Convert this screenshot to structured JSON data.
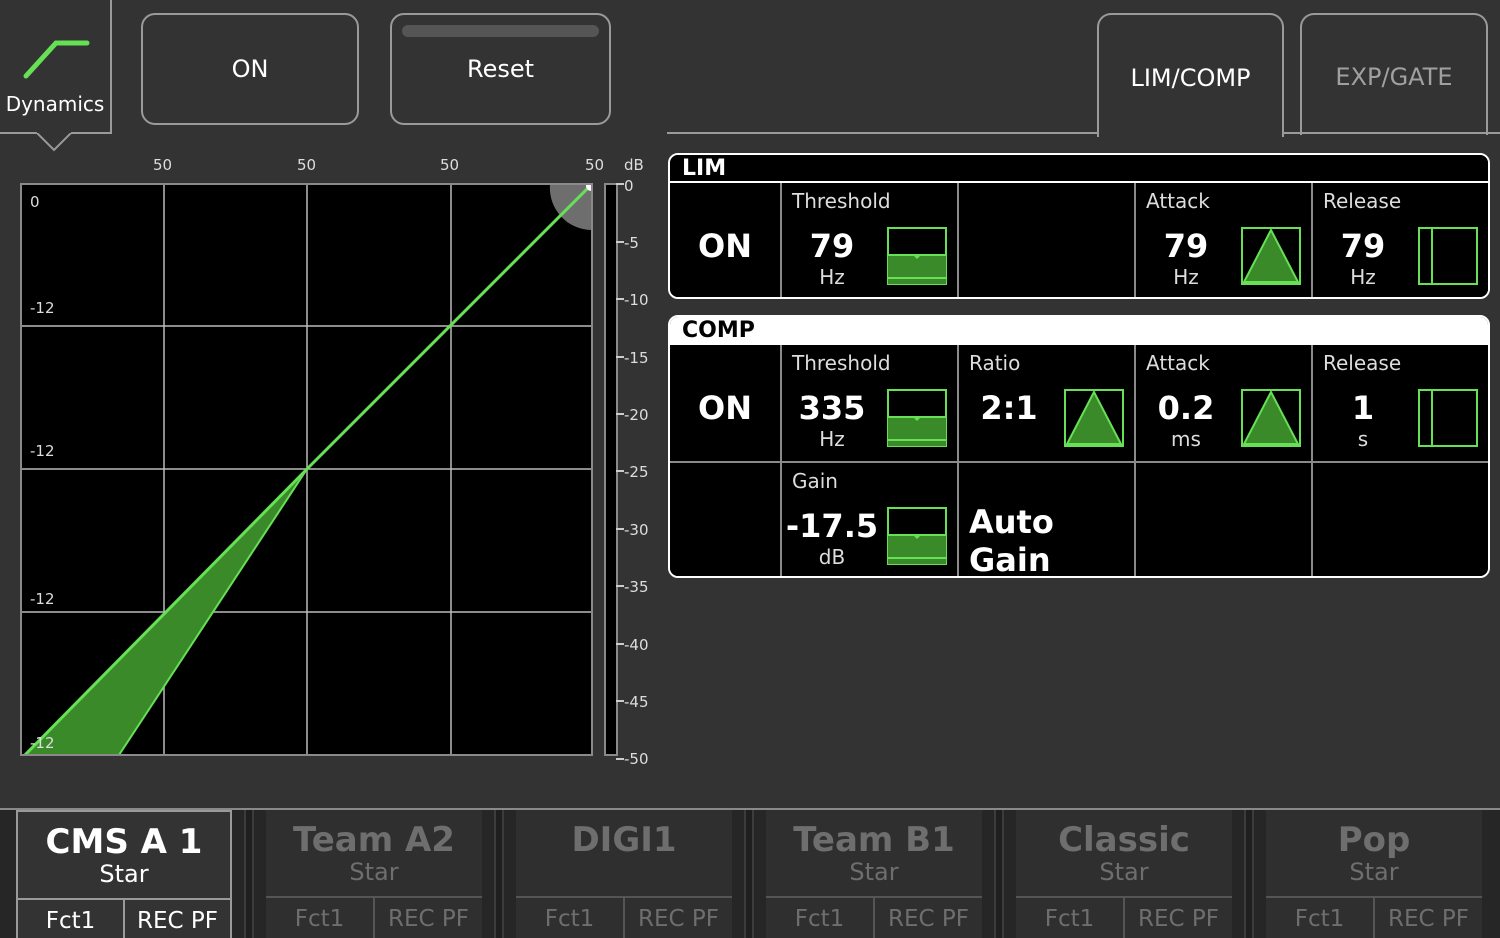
{
  "header": {
    "module_label": "Dynamics",
    "on_label": "ON",
    "reset_label": "Reset"
  },
  "tabs": [
    {
      "label": "LIM/COMP",
      "active": true
    },
    {
      "label": "EXP/GATE",
      "active": false
    }
  ],
  "graph": {
    "x_ticks": [
      "50",
      "50",
      "50",
      "50"
    ],
    "x_unit": "dB",
    "y_labels": [
      "0",
      "-12",
      "-12",
      "-12",
      "-12"
    ],
    "meter_scale": [
      "0",
      "-5",
      "-10",
      "-15",
      "-20",
      "-25",
      "-30",
      "-35",
      "-40",
      "-45",
      "-50"
    ],
    "accent_color": "#66e055",
    "fill_color": "#3a8a2a"
  },
  "lim": {
    "title": "LIM",
    "state": "ON",
    "threshold": {
      "label": "Threshold",
      "value": "79",
      "unit": "Hz"
    },
    "attack": {
      "label": "Attack",
      "value": "79",
      "unit": "Hz"
    },
    "release": {
      "label": "Release",
      "value": "79",
      "unit": "Hz"
    }
  },
  "comp": {
    "title": "COMP",
    "state": "ON",
    "threshold": {
      "label": "Threshold",
      "value": "335",
      "unit": "Hz"
    },
    "ratio": {
      "label": "Ratio",
      "value": "2:1"
    },
    "attack": {
      "label": "Attack",
      "value": "0.2",
      "unit": "ms"
    },
    "release": {
      "label": "Release",
      "value": "1",
      "unit": "s"
    },
    "gain": {
      "label": "Gain",
      "value": "-17.5",
      "unit": "dB"
    },
    "auto_gain": "Auto Gain"
  },
  "channels": [
    {
      "name": "CMS A 1",
      "sub": "Star",
      "f1": "Fct1",
      "f2": "REC PF",
      "active": true
    },
    {
      "name": "Team A2",
      "sub": "Star",
      "f1": "Fct1",
      "f2": "REC PF",
      "active": false
    },
    {
      "name": "DIGI1",
      "sub": "",
      "f1": "Fct1",
      "f2": "REC PF",
      "active": false
    },
    {
      "name": "Team B1",
      "sub": "Star",
      "f1": "Fct1",
      "f2": "REC PF",
      "active": false
    },
    {
      "name": "Classic",
      "sub": "Star",
      "f1": "Fct1",
      "f2": "REC PF",
      "active": false
    },
    {
      "name": "Pop",
      "sub": "Star",
      "f1": "Fct1",
      "f2": "REC PF",
      "active": false
    }
  ]
}
